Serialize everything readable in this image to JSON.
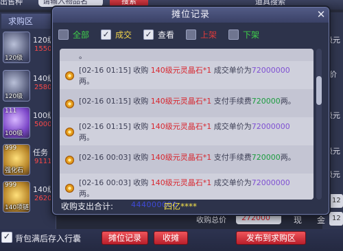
{
  "background": {
    "top_label": "出售种",
    "top_field": "请输入物品名",
    "top_button": "搜索",
    "top_right_label": "道具搜索",
    "left_panel_title": "求购区",
    "left_items": [
      {
        "badge": "",
        "level": "120级",
        "name": "120级",
        "price": "1550",
        "icon_style": "silver"
      },
      {
        "badge": "",
        "level": "120级",
        "name": "140级",
        "price": "2580",
        "icon_style": "silver"
      },
      {
        "badge": "111",
        "level": "100级",
        "name": "100级",
        "price": "5000",
        "icon_style": "purple"
      },
      {
        "badge": "999",
        "level": "强化石",
        "name": "任务",
        "price": "9111",
        "icon_style": "gold"
      },
      {
        "badge": "999",
        "level": "140项链",
        "name": "140级",
        "price": "2620",
        "icon_style": "gold"
      }
    ],
    "right_labels": [
      "级元",
      "价",
      "级元",
      "级元",
      "级元"
    ],
    "right_boxes": [
      "12",
      "12"
    ],
    "total_label": "收购总价",
    "total_value": "272000",
    "bottom_extra_1": "现",
    "bottom_extra_2": "金",
    "bottom_checkbox_label": "背包满后存入行囊",
    "buttons": {
      "stall_log": "摊位记录",
      "close_stall": "收摊",
      "publish": "发布到求购区"
    }
  },
  "modal": {
    "title": "摊位记录",
    "close_symbol": "✕",
    "filters": [
      {
        "label": "全部",
        "checked": false,
        "color": "#3ecf4a"
      },
      {
        "label": "成交",
        "checked": true,
        "color": "#f2d44b"
      },
      {
        "label": "查看",
        "checked": true,
        "color": "#f2f2f7"
      },
      {
        "label": "上架",
        "checked": false,
        "color": "#e03a3a"
      },
      {
        "label": "下架",
        "checked": false,
        "color": "#3ecf4a"
      }
    ],
    "top_fragment": "。",
    "entries": [
      {
        "time": "[02-16 01:15]",
        "action": "收购",
        "item": "140级元灵晶石*1",
        "desc": "成交单价为",
        "amount": "72000000",
        "amount_color": "purple",
        "tail": "两。"
      },
      {
        "time": "[02-16 01:15]",
        "action": "收购",
        "item": "140级元灵晶石*1",
        "desc": "支付手续费",
        "amount": "720000",
        "amount_color": "green",
        "tail": "两。"
      },
      {
        "time": "[02-16 01:15]",
        "action": "收购",
        "item": "140级元灵晶石*1",
        "desc": "成交单价为",
        "amount": "72000000",
        "amount_color": "purple",
        "tail": "两。"
      },
      {
        "time": "[02-16 00:03]",
        "action": "收购",
        "item": "140级元灵晶石*1",
        "desc": "支付手续费",
        "amount": "720000",
        "amount_color": "green",
        "tail": "两。"
      },
      {
        "time": "[02-16 00:03]",
        "action": "收购",
        "item": "140级元灵晶石*1",
        "desc": "成交单价为",
        "amount": "72000000",
        "amount_color": "purple",
        "tail": "两。"
      }
    ],
    "summary": {
      "label": "收购支出合计:",
      "value": "444000000",
      "words": "四亿****"
    }
  }
}
